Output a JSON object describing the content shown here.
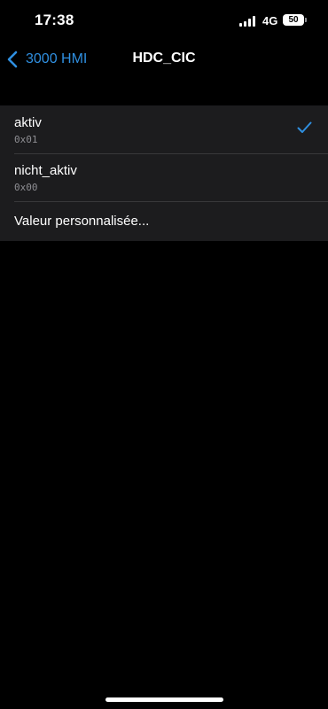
{
  "status_bar": {
    "time": "17:38",
    "network": "4G",
    "battery": "50"
  },
  "nav": {
    "back_label": "3000 HMI",
    "title": "HDC_CIC"
  },
  "options": [
    {
      "label": "aktiv",
      "value": "0x01",
      "selected": true
    },
    {
      "label": "nicht_aktiv",
      "value": "0x00",
      "selected": false
    }
  ],
  "custom_value_label": "Valeur personnalisée...",
  "colors": {
    "accent": "#2f8fe0",
    "cell_background": "#1c1c1e",
    "background": "#000000"
  }
}
